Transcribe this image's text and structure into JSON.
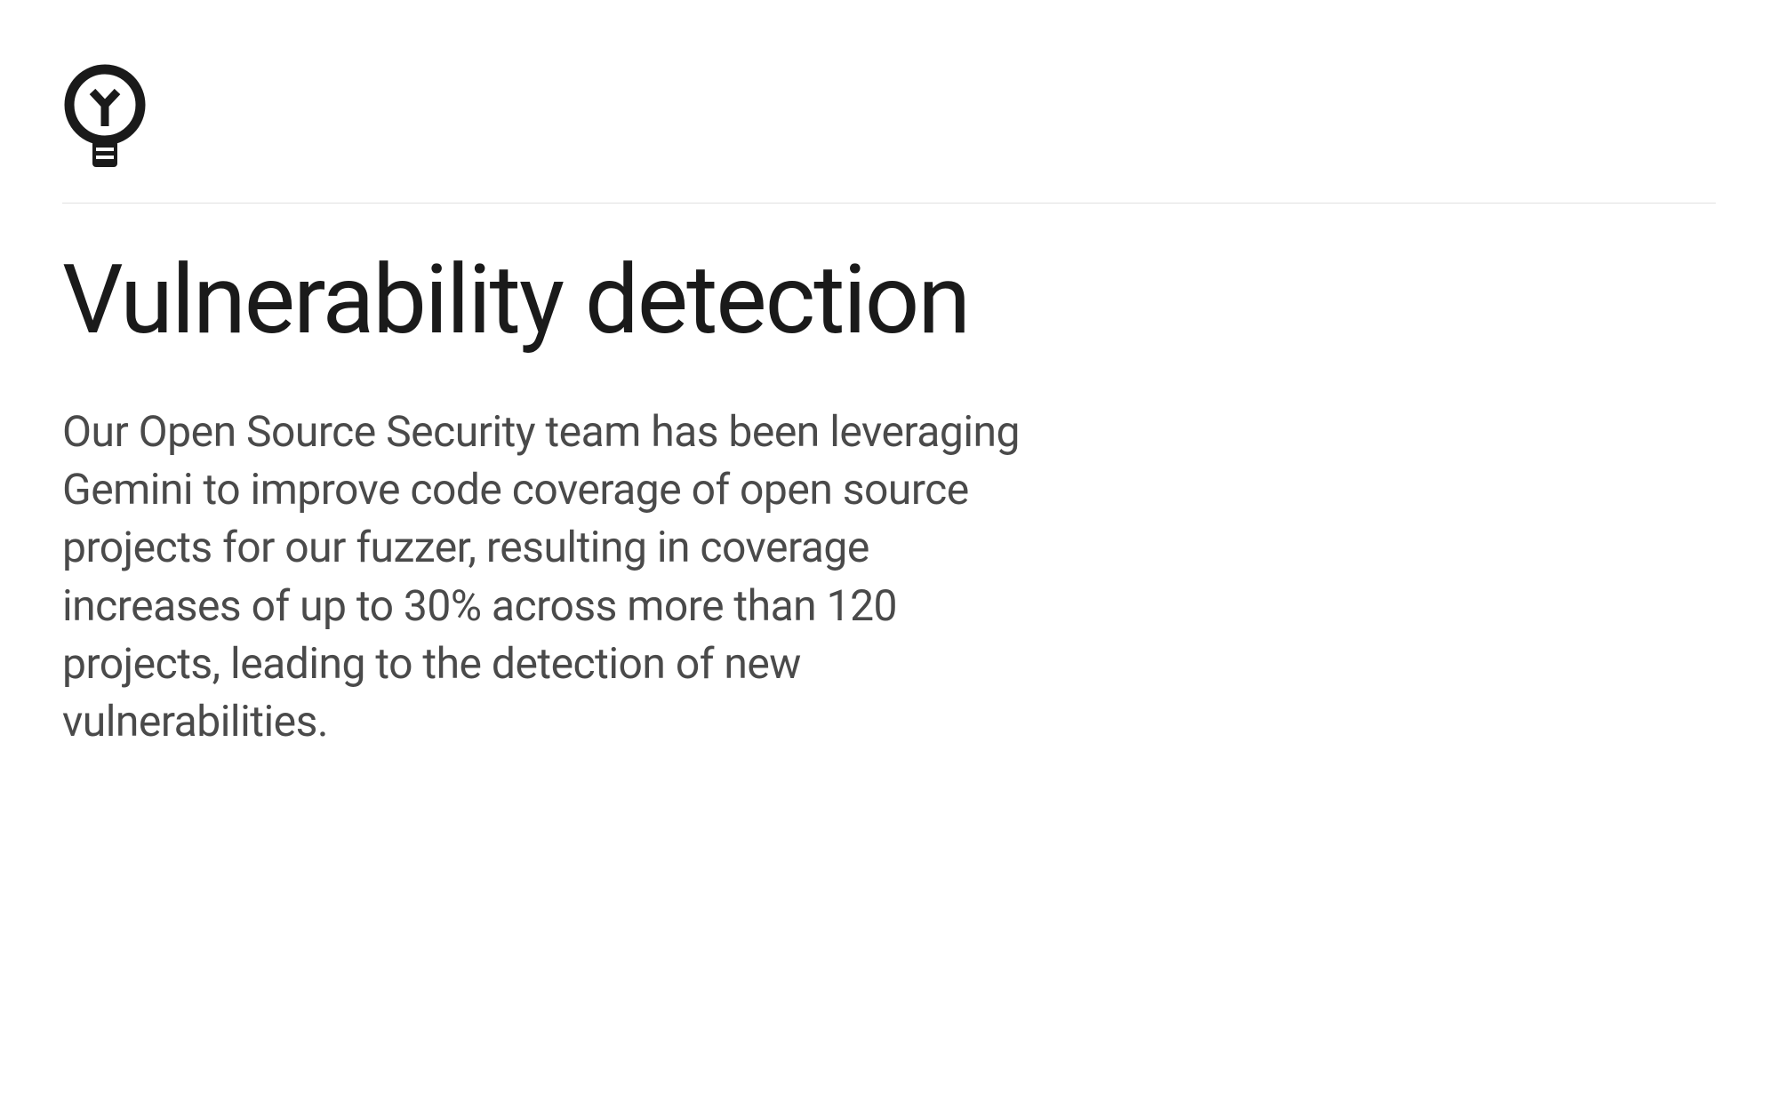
{
  "content": {
    "icon_name": "lightbulb-icon",
    "heading": "Vulnerability detection",
    "body": "Our Open Source Security team has been leveraging Gemini to improve code coverage of open source projects for our fuzzer, resulting in coverage increases of up to 30% across more than 120 projects, leading to the detection of new vulnerabilities."
  },
  "colors": {
    "heading_color": "#1a1a1a",
    "body_color": "#4a4a4a",
    "divider_color": "#e0e0e0",
    "icon_color": "#1a1a1a"
  }
}
